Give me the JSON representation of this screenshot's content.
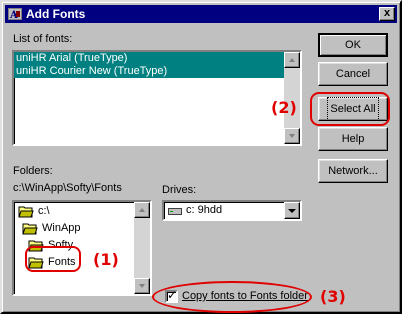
{
  "window": {
    "title": "Add Fonts",
    "close_glyph": "x"
  },
  "fonts_list": {
    "label": "List of fonts:",
    "items": [
      "uniHR Arial (TrueType)",
      "uniHR Courier New (TrueType)"
    ]
  },
  "folders": {
    "label": "Folders:",
    "current_path": "c:\\WinApp\\Softy\\Fonts",
    "tree": [
      {
        "name": "c:\\",
        "icon": "open-folder-icon"
      },
      {
        "name": "WinApp",
        "icon": "open-folder-icon"
      },
      {
        "name": "Softy",
        "icon": "open-folder-icon"
      },
      {
        "name": "Fonts",
        "icon": "open-folder-icon"
      }
    ]
  },
  "drives": {
    "label": "Drives:",
    "selected": "c: 9hdd",
    "icon": "hard-drive-icon"
  },
  "buttons": {
    "ok": "OK",
    "cancel": "Cancel",
    "select_all": "Select All",
    "help": "Help",
    "network": "Network..."
  },
  "copy_option": {
    "label": "Copy fonts to Fonts folder",
    "checked": true
  },
  "annotations": {
    "one": "(1)",
    "two": "(2)",
    "three": "(3)",
    "color": "#e00000"
  },
  "colors": {
    "titlebar": "#000080",
    "selection": "#008080",
    "dialog_face": "#c0c0c0"
  }
}
